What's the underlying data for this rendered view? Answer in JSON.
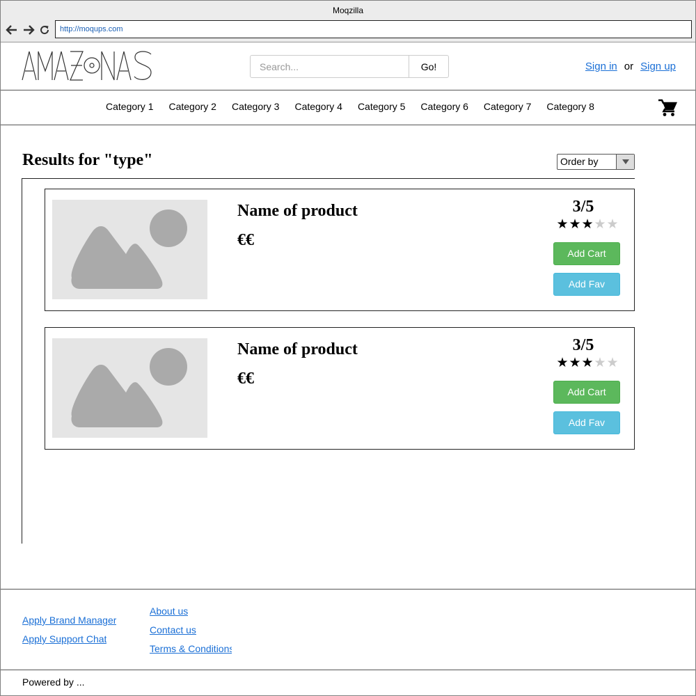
{
  "browser": {
    "title": "Moqzilla",
    "url": "http://moqups.com"
  },
  "header": {
    "logo_text": "AMAZONAS",
    "search_placeholder": "Search...",
    "search_button": "Go!",
    "sign_in": "Sign in",
    "or": "or",
    "sign_up": "Sign up"
  },
  "categories": [
    "Category 1",
    "Category 2",
    "Category 3",
    "Category 4",
    "Category 5",
    "Category 6",
    "Category 7",
    "Category 8"
  ],
  "results": {
    "title": "Results for \"type\"",
    "order_by": "Order by"
  },
  "products": [
    {
      "name": "Name of product",
      "price": "€€",
      "rating": "3/5",
      "stars_filled": 3,
      "stars_total": 5,
      "add_cart": "Add Cart",
      "add_fav": "Add Fav"
    },
    {
      "name": "Name of product",
      "price": "€€",
      "rating": "3/5",
      "stars_filled": 3,
      "stars_total": 5,
      "add_cart": "Add Cart",
      "add_fav": "Add Fav"
    }
  ],
  "footer": {
    "col1": [
      "Apply Brand Manager",
      "Apply Support Chat"
    ],
    "col2": [
      "About us",
      "Contact us",
      "Terms & Conditions"
    ],
    "powered_by": "Powered by ..."
  },
  "colors": {
    "link": "#1a6fd6",
    "add_cart": "#5cb85c",
    "add_fav": "#5bc0de",
    "star_filled": "#000000",
    "star_empty": "#cccccc"
  }
}
